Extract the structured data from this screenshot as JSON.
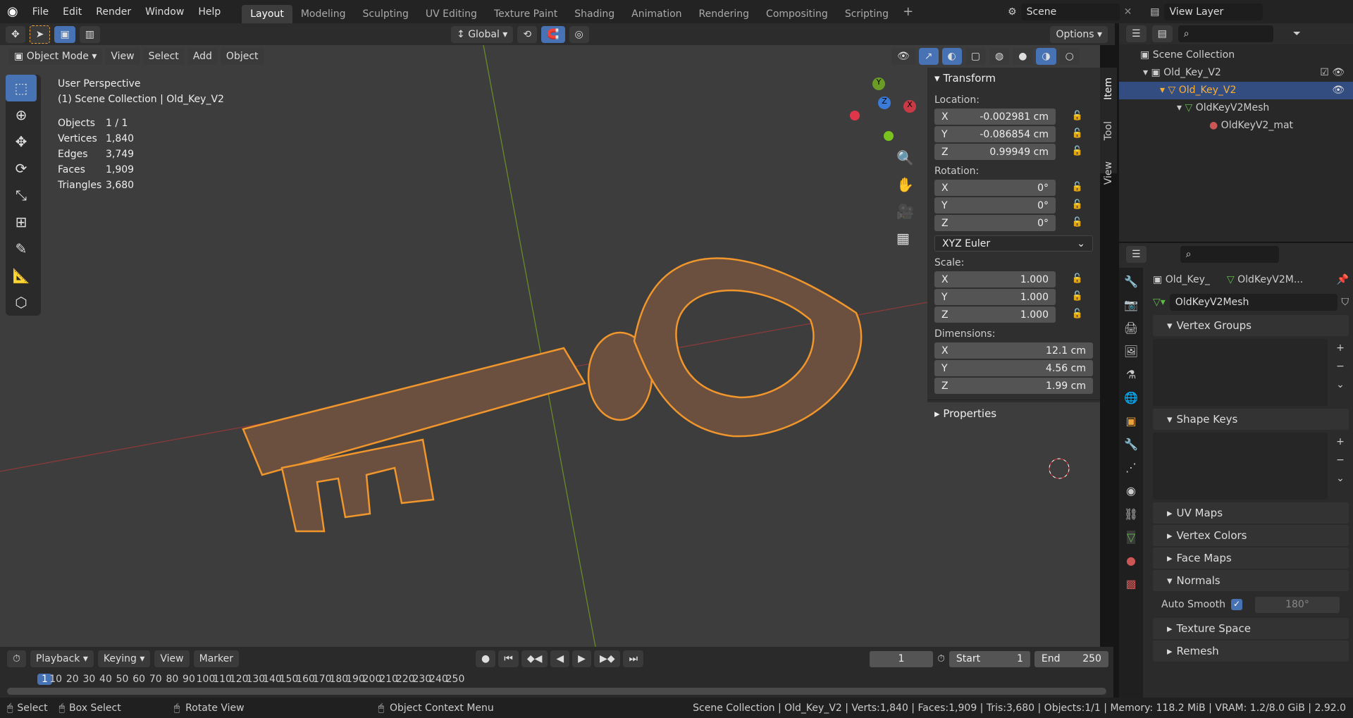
{
  "menu": [
    "File",
    "Edit",
    "Render",
    "Window",
    "Help"
  ],
  "workspaces": [
    "Layout",
    "Modeling",
    "Sculpting",
    "UV Editing",
    "Texture Paint",
    "Shading",
    "Animation",
    "Rendering",
    "Compositing",
    "Scripting"
  ],
  "active_workspace": "Layout",
  "scene": "Scene",
  "view_layer": "View Layer",
  "header": {
    "orientation": "Global",
    "options": "Options"
  },
  "viewport_header": {
    "mode": "Object Mode",
    "menus": [
      "View",
      "Select",
      "Add",
      "Object"
    ]
  },
  "overlay": {
    "title": "User Perspective",
    "subtitle": "(1) Scene Collection | Old_Key_V2",
    "stats": [
      [
        "Objects",
        "1 / 1"
      ],
      [
        "Vertices",
        "1,840"
      ],
      [
        "Edges",
        "3,749"
      ],
      [
        "Faces",
        "1,909"
      ],
      [
        "Triangles",
        "3,680"
      ]
    ]
  },
  "gizmo": {
    "x": "X",
    "y": "Y",
    "z": "Z"
  },
  "npanel": {
    "tabs": [
      "Item",
      "Tool",
      "View"
    ],
    "transform": "Transform",
    "location": "Location:",
    "loc": [
      [
        "X",
        "-0.002981 cm"
      ],
      [
        "Y",
        "-0.086854 cm"
      ],
      [
        "Z",
        "0.99949 cm"
      ]
    ],
    "rotation": "Rotation:",
    "rot": [
      [
        "X",
        "0°"
      ],
      [
        "Y",
        "0°"
      ],
      [
        "Z",
        "0°"
      ]
    ],
    "rot_mode": "XYZ Euler",
    "scale": "Scale:",
    "scl": [
      [
        "X",
        "1.000"
      ],
      [
        "Y",
        "1.000"
      ],
      [
        "Z",
        "1.000"
      ]
    ],
    "dimensions": "Dimensions:",
    "dim": [
      [
        "X",
        "12.1 cm"
      ],
      [
        "Y",
        "4.56 cm"
      ],
      [
        "Z",
        "1.99 cm"
      ]
    ],
    "properties": "Properties"
  },
  "outliner": {
    "items": [
      "Scene Collection",
      "Old_Key_V2",
      "Old_Key_V2",
      "OldKeyV2Mesh",
      "OldKeyV2_mat"
    ]
  },
  "properties": {
    "object": "Old_Key_",
    "mesh_crumb": "OldKeyV2M...",
    "mesh_name": "OldKeyV2Mesh",
    "sections": [
      "Vertex Groups",
      "Shape Keys",
      "UV Maps",
      "Vertex Colors",
      "Face Maps",
      "Normals"
    ],
    "auto_smooth": "Auto Smooth",
    "angle": "180°",
    "more": [
      "Texture Space",
      "Remesh"
    ]
  },
  "timeline": {
    "menus": [
      "Playback",
      "Keying",
      "View",
      "Marker"
    ],
    "current": "1",
    "start_label": "Start",
    "start": "1",
    "end_label": "End",
    "end": "250",
    "ticks": [
      "1",
      "10",
      "20",
      "30",
      "40",
      "50",
      "60",
      "70",
      "80",
      "90",
      "100",
      "110",
      "120",
      "130",
      "140",
      "150",
      "160",
      "170",
      "180",
      "190",
      "200",
      "210",
      "220",
      "230",
      "240",
      "250"
    ]
  },
  "status": {
    "select": "Select",
    "box": "Box Select",
    "rotate": "Rotate View",
    "context": "Object Context Menu",
    "info": "Scene Collection | Old_Key_V2 | Verts:1,840 | Faces:1,909 | Tris:3,680 | Objects:1/1 | Memory: 118.2 MiB | VRAM: 1.2/8.0 GiB | 2.92.0"
  }
}
